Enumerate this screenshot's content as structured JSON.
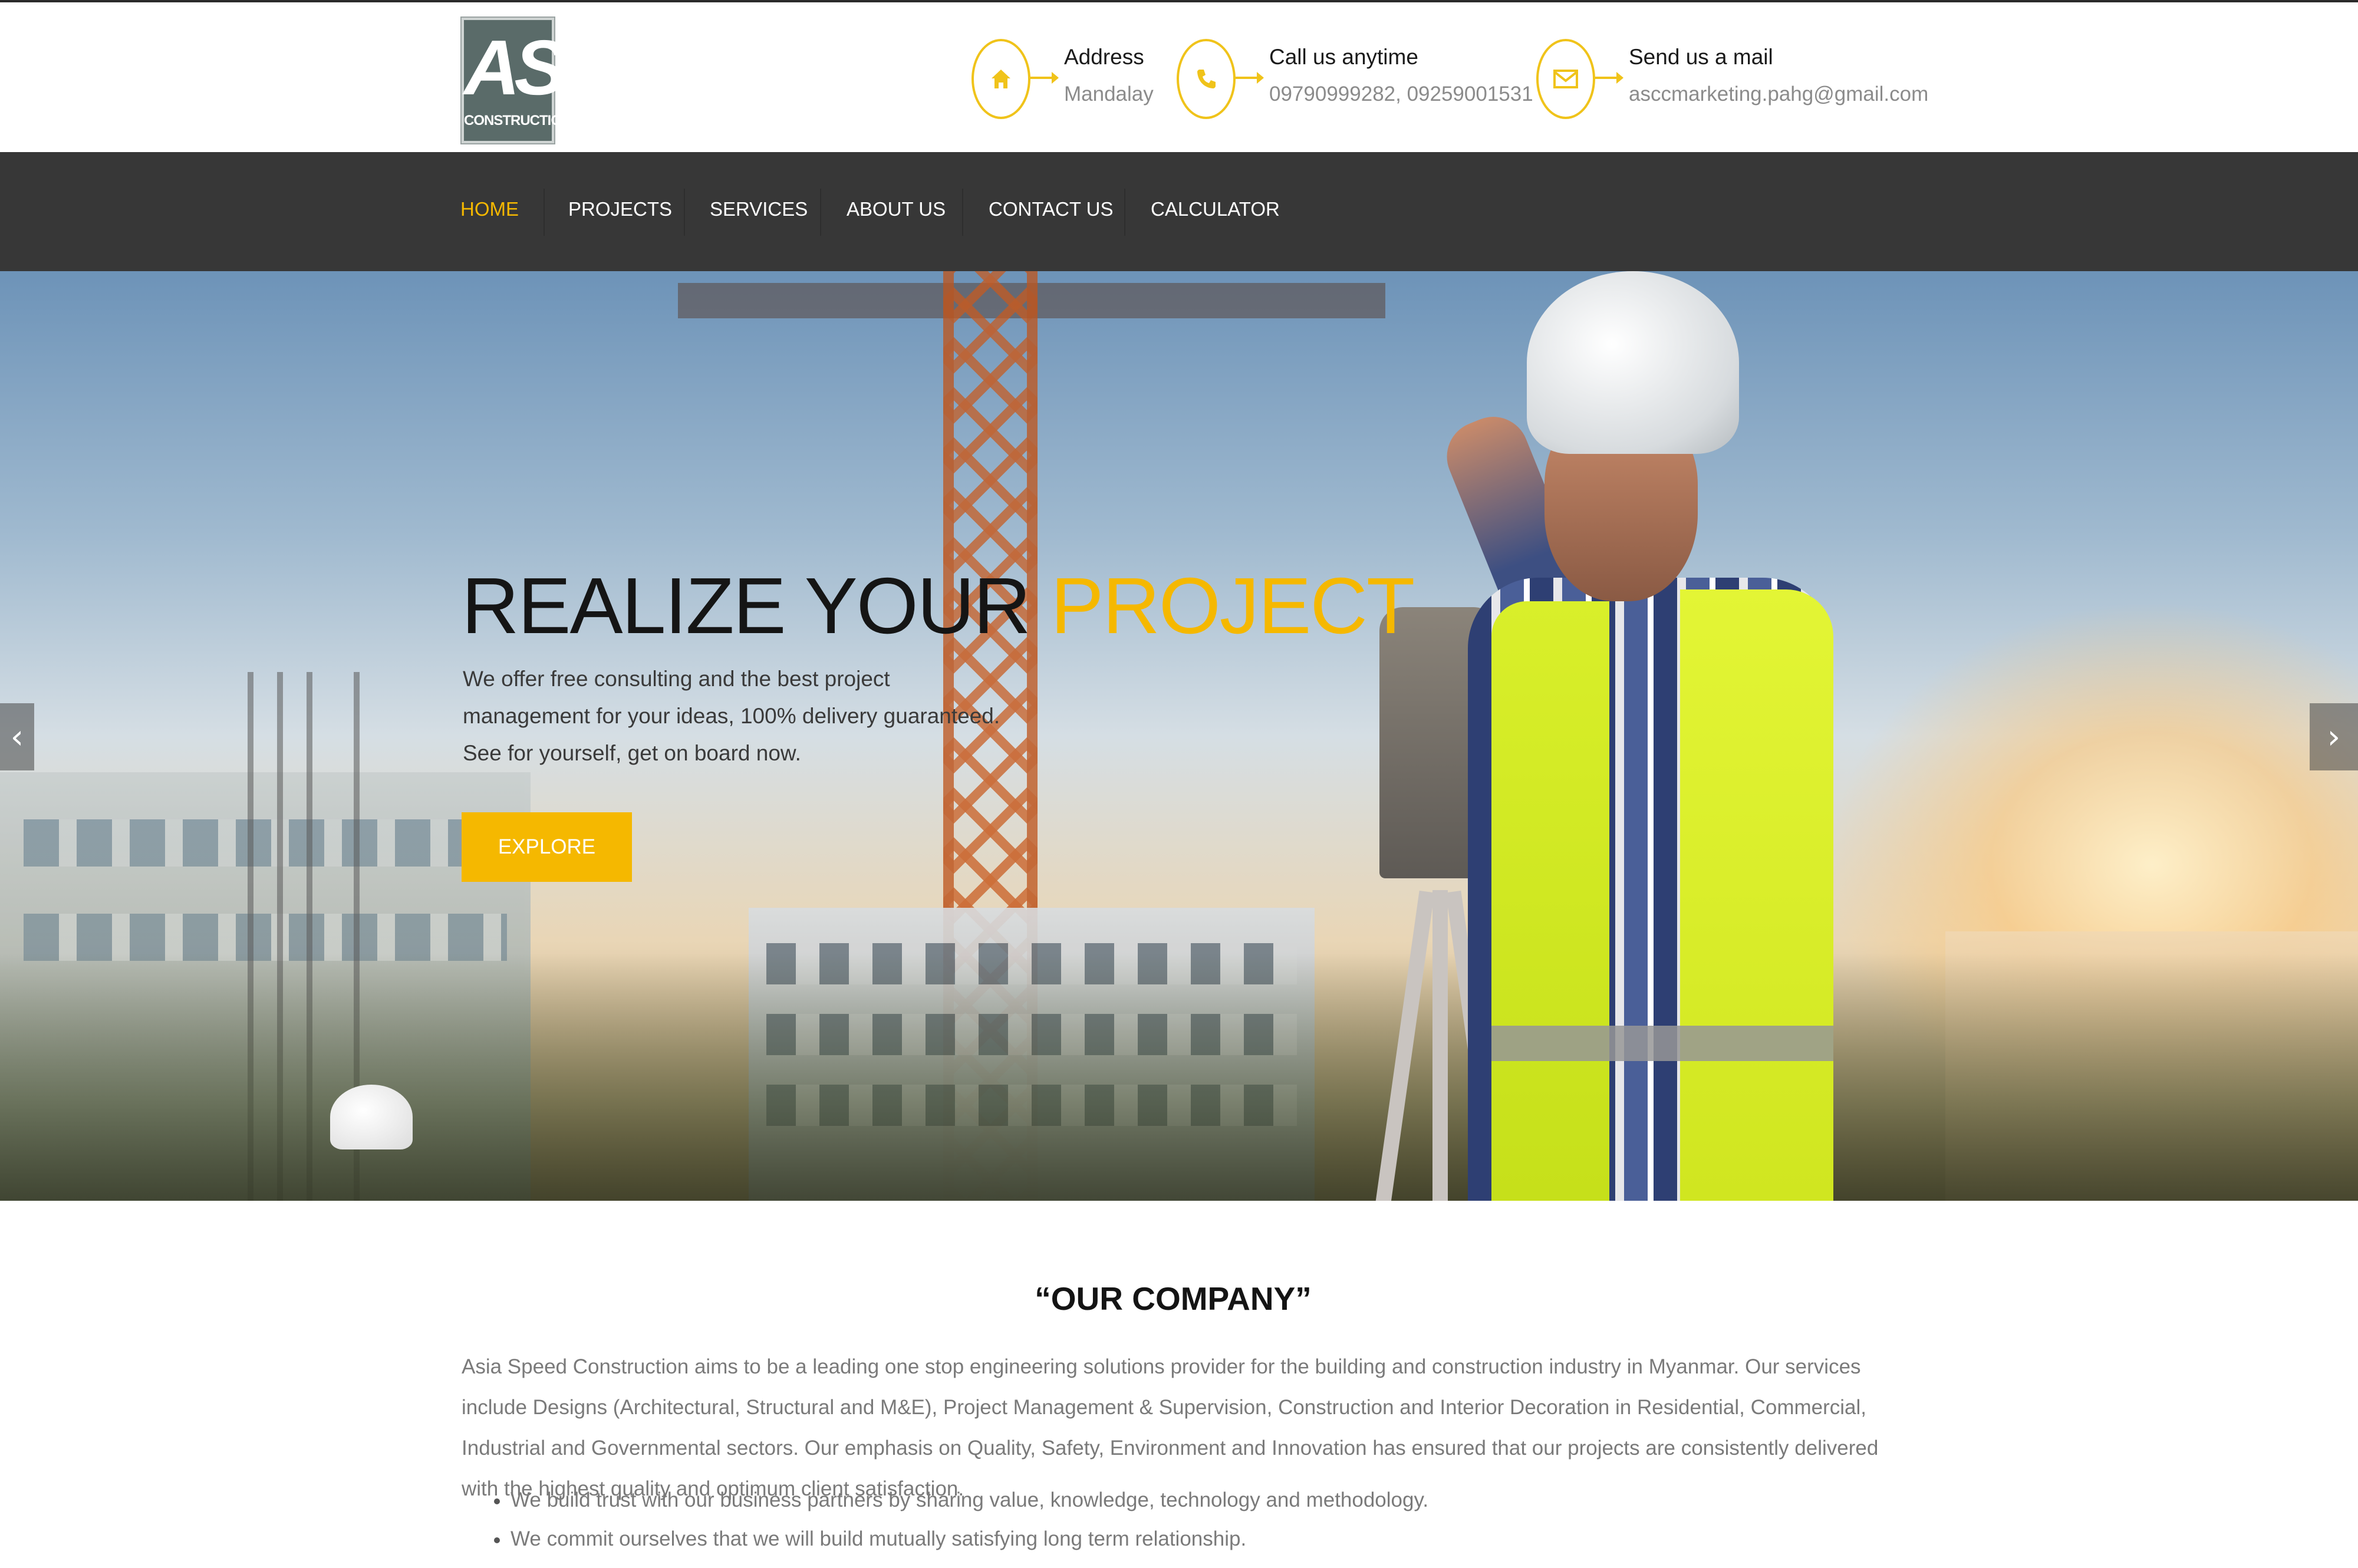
{
  "brand": {
    "logo_mark": "AS",
    "logo_sub": "CONSTRUCTION"
  },
  "contacts": [
    {
      "icon": "home-icon",
      "title": "Address",
      "value": "Mandalay"
    },
    {
      "icon": "phone-icon",
      "title": "Call us anytime",
      "value": "09790999282, 09259001531"
    },
    {
      "icon": "mail-icon",
      "title": "Send us a mail",
      "value": "asccmarketing.pahg@gmail.com"
    }
  ],
  "nav": {
    "items": [
      "HOME",
      "PROJECTS",
      "SERVICES",
      "ABOUT US",
      "CONTACT US",
      "CALCULATOR"
    ],
    "active": "HOME"
  },
  "hero": {
    "title_main": "REALIZE YOUR ",
    "title_accent": "PROJECT",
    "text": "We offer free consulting and the best project management for your ideas, 100% delivery guaranteed. See for yourself, get on board now.",
    "button": "EXPLORE",
    "prev_arrow": "‹",
    "next_arrow": "›"
  },
  "company": {
    "title": "“OUR COMPANY”",
    "text": "Asia Speed Construction aims to be a leading one stop engineering solutions provider for the building and construction industry in Myanmar. Our services include Designs (Architectural, Structural and M&E), Project Management & Supervision, Construction and Interior Decoration in Residential, Commercial, Industrial and Governmental sectors. Our emphasis on Quality, Safety, Environment and Innovation has ensured that our projects are consistently delivered with the highest quality and optimum client satisfaction.",
    "points": [
      "We build trust with our business partners by sharing value, knowledge, technology and methodology.",
      "We commit ourselves that we will build mutually satisfying long term relationship."
    ]
  },
  "colors": {
    "accent": "#f5b800",
    "nav_bg": "#373737",
    "logo_bg": "#5a6b69"
  }
}
